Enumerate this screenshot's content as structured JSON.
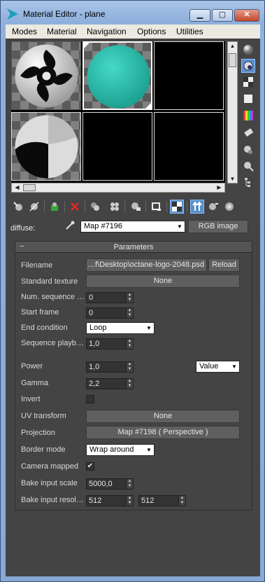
{
  "window": {
    "title": "Material Editor - plane"
  },
  "menu": [
    "Modes",
    "Material",
    "Navigation",
    "Options",
    "Utilities"
  ],
  "diffuse_label": "diffuse:",
  "map_selector": {
    "value": "Map #7196"
  },
  "map_type_button": "RGB image",
  "rollout": {
    "title": "Parameters",
    "toggle": "−"
  },
  "params": {
    "filename": {
      "label": "Filename",
      "value": "…f\\Desktop\\octane-logo-2048.psd",
      "reload": "Reload"
    },
    "standard_texture": {
      "label": "Standard texture",
      "value": "None"
    },
    "num_sequence": {
      "label": "Num. sequence …",
      "value": "0"
    },
    "start_frame": {
      "label": "Start frame",
      "value": "0"
    },
    "end_condition": {
      "label": "End condition",
      "value": "Loop"
    },
    "sequence_playback": {
      "label": "Sequence playb…",
      "value": "1,0"
    },
    "power": {
      "label": "Power",
      "value": "1,0",
      "mode": "Value"
    },
    "gamma": {
      "label": "Gamma",
      "value": "2,2"
    },
    "invert": {
      "label": "Invert",
      "checked": false
    },
    "uv_transform": {
      "label": "UV transform",
      "value": "None"
    },
    "projection": {
      "label": "Projection",
      "value": "Map #7198  ( Perspective )"
    },
    "border_mode": {
      "label": "Border mode",
      "value": "Wrap around"
    },
    "camera_mapped": {
      "label": "Camera mapped",
      "checked": true,
      "mark": "✔"
    },
    "bake_input_scale": {
      "label": "Bake input scale",
      "value": "5000,0"
    },
    "bake_input_resolution": {
      "label": "Bake input resol…",
      "width": "512",
      "height": "512"
    }
  },
  "icons": {
    "window": [
      "app-icon",
      "minimize-icon",
      "maximize-icon",
      "close-icon"
    ],
    "side_tools": [
      "sample-type-sphere-icon",
      "backlight-icon",
      "background-checker-icon",
      "sample-uv-tiling-icon",
      "video-color-check-icon",
      "make-preview-icon",
      "options-icon",
      "select-by-material-icon",
      "material-map-navigator-icon"
    ],
    "bottom_tools": [
      "get-material-icon",
      "put-material-to-scene-icon",
      "assign-material-icon",
      "reset-map-icon",
      "copy-material-icon",
      "make-unique-icon",
      "put-to-library-icon",
      "material-id-channel-icon",
      "show-shaded-material-icon",
      "show-end-result-icon",
      "go-to-parent-icon",
      "go-forward-to-sibling-icon",
      "pick-from-object-icon"
    ]
  },
  "colors": {
    "panel": "#444444",
    "teal_sphere": "#2bbfae",
    "active_tool": "#5a8fc8"
  }
}
